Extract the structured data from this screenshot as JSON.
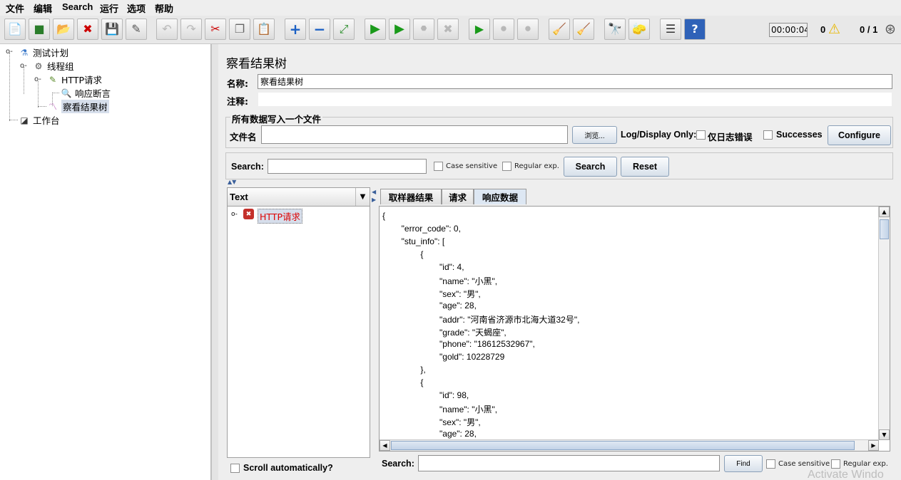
{
  "menu": [
    "文件",
    "编辑",
    "Search",
    "运行",
    "选项",
    "帮助"
  ],
  "toolbar": {
    "timer": "00:00:04",
    "warnings": "0",
    "threads": "0 / 1"
  },
  "tree": {
    "test_plan": "测试计划",
    "thread_group": "线程组",
    "http_request": "HTTP请求",
    "response_assertion": "响应断言",
    "result_tree": "察看结果树",
    "workbench": "工作台"
  },
  "panel": {
    "title": "察看结果树",
    "name_label": "名称:",
    "name_value": "察看结果树",
    "comment_label": "注释:",
    "comment_value": "",
    "file_group_title": "所有数据写入一个文件",
    "filename_label": "文件名",
    "filename_value": "",
    "browse_label": "浏览...",
    "log_display_label": "Log/Display Only:",
    "errors_only_label": "仅日志错误",
    "successes_label": "Successes",
    "configure_label": "Configure"
  },
  "search": {
    "label": "Search:",
    "value": "",
    "case_sensitive": "Case sensitive",
    "regex": "Regular exp.",
    "search_button": "Search",
    "reset_button": "Reset"
  },
  "results": {
    "renderer": "Text",
    "sample": "HTTP请求",
    "scroll_auto": "Scroll automatically?"
  },
  "tabs": [
    "取样器结果",
    "请求",
    "响应数据"
  ],
  "response_lines": [
    "{",
    "        \"error_code\": 0,",
    "        \"stu_info\": [",
    "                {",
    "                        \"id\": 4,",
    "                        \"name\": \"小黑\",",
    "                        \"sex\": \"男\",",
    "                        \"age\": 28,",
    "                        \"addr\": \"河南省济源市北海大道32号\",",
    "                        \"grade\": \"天蝎座\",",
    "                        \"phone\": \"18612532967\",",
    "                        \"gold\": 10228729",
    "                },",
    "                {",
    "                        \"id\": 98,",
    "                        \"name\": \"小黑\",",
    "                        \"sex\": \"男\",",
    "                        \"age\": 28,"
  ],
  "find": {
    "label": "Search:",
    "value": "",
    "find_button": "Find",
    "case_sensitive": "Case sensitive",
    "regex": "Regular exp."
  },
  "watermark": "Activate Windo"
}
